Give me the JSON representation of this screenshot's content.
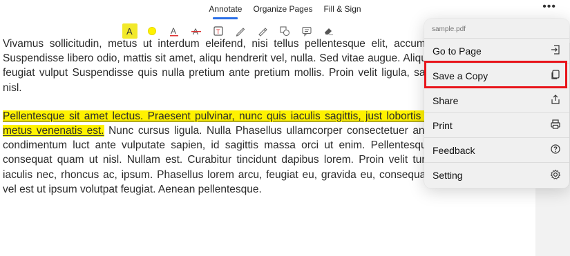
{
  "tabs": [
    {
      "label": "Annotate",
      "active": true
    },
    {
      "label": "Organize Pages",
      "active": false
    },
    {
      "label": "Fill & Sign",
      "active": false
    }
  ],
  "more_icon": "more-horizontal-icon",
  "toolbar": [
    "text-highlight-icon",
    "color-dot-icon",
    "text-underline-icon",
    "text-strikethrough-icon",
    "text-box-icon",
    "pencil-icon",
    "highlighter-pen-icon",
    "shapes-icon",
    "comment-icon",
    "eraser-icon"
  ],
  "colors": {
    "highlight": "#fff200",
    "accent": "#2a6fe8",
    "callout": "#e8141a"
  },
  "document": {
    "para1": "Vivamus sollicitudin, metus ut interdum eleifend, nisi tellus pellentesque elit, accumsan eros quam et risus. Suspendisse libero odio, mattis sit amet, aliqu hendrerit vel, nulla. Sed vitae augue. Aliquam erat volutpat. Aliquam feugiat vulput Suspendisse quis nulla pretium ante pretium mollis. Proin velit ligula, sagittis at, eg pulvinar quis, nisl.",
    "para2_highlight": "Pellentesque sit amet lectus. Praesent pulvinar, nunc quis iaculis sagittis, just lobortis tortor, sed vestibulum dui metus venenatis est.",
    "para2_rest": " Nunc cursus ligula. Nulla Phasellus ullamcorper consectetuer ante. Duis tincidunt, urna id condimentum luct ante vulputate sapien, id sagittis massa orci ut enim. Pellentesque vestibulum sem. Nulla consequat quam ut nisl. Nullam est. Curabitur tincidunt dapibus lorem. Proin velit turpis, scelerisque sit amet, iaculis nec, rhoncus ac, ipsum. Phasellus lorem arcu, feugiat eu, gravida eu, consequat molestie, ipsum. Nullam vel est ut ipsum volutpat feugiat. Aenean pellentesque."
  },
  "menu": {
    "header": "sample.pdf",
    "items": [
      {
        "label": "Go to Page",
        "icon": "go-to-page-icon"
      },
      {
        "label": "Save a Copy",
        "icon": "copy-icon"
      },
      {
        "label": "Share",
        "icon": "share-icon"
      },
      {
        "label": "Print",
        "icon": "printer-icon"
      },
      {
        "label": "Feedback",
        "icon": "feedback-icon"
      },
      {
        "label": "Setting",
        "icon": "gear-icon"
      }
    ]
  }
}
